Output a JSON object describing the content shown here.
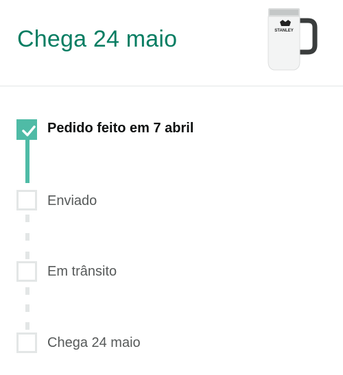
{
  "header": {
    "title": "Chega 24 maio",
    "product_icon": "stanley-beer-stein",
    "product_brand": "STANLEY"
  },
  "steps": [
    {
      "label": "Pedido feito em 7 abril",
      "completed": true
    },
    {
      "label": "Enviado",
      "completed": false
    },
    {
      "label": "Em trânsito",
      "completed": false
    },
    {
      "label": "Chega 24 maio",
      "completed": false
    }
  ],
  "colors": {
    "accent": "#067d62",
    "progress": "#4fbba6",
    "inactive": "#e3e6e6",
    "text_primary": "#0f1111",
    "text_secondary": "#565959"
  }
}
